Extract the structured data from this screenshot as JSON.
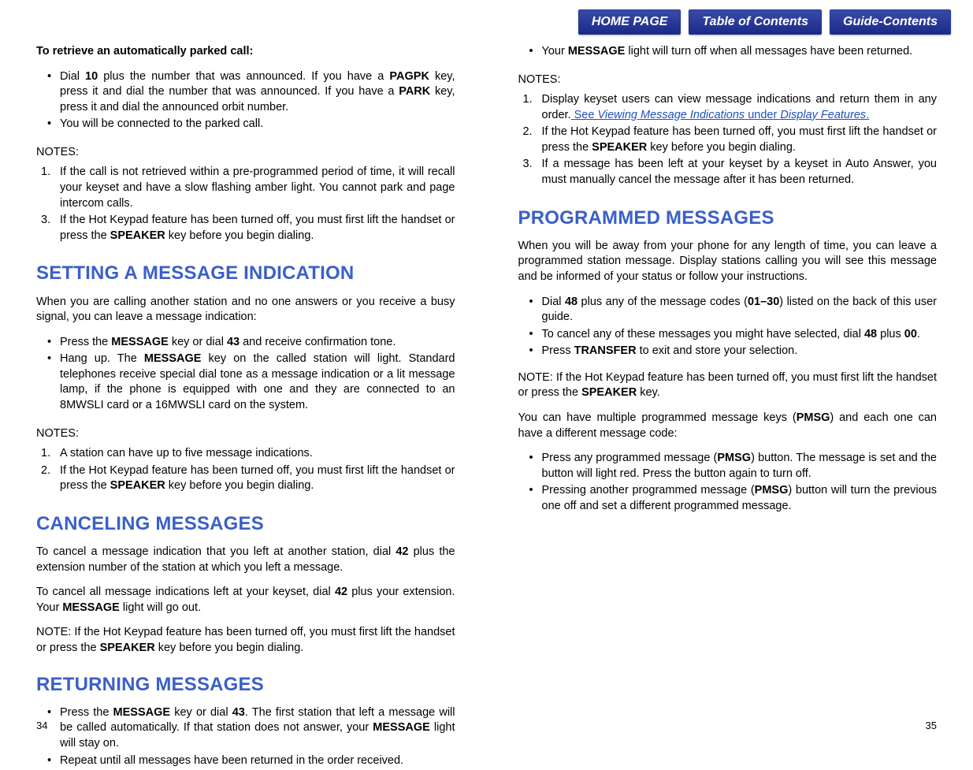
{
  "nav": {
    "home": "HOME PAGE",
    "toc": "Table of Contents",
    "guide": "Guide-Contents"
  },
  "left": {
    "retrieve_intro": "To retrieve an automatically parked call:",
    "retrieve_b1_a": "Dial ",
    "retrieve_b1_b": "10",
    "retrieve_b1_c": " plus the number that was announced. If you have a ",
    "retrieve_b1_d": "PAGPK",
    "retrieve_b1_e": " key, press it and dial the number that was announced. If you have a ",
    "retrieve_b1_f": "PARK",
    "retrieve_b1_g": " key, press it and dial the announced orbit number.",
    "retrieve_b2": "You will be connected to the parked call.",
    "notes_label": "NOTES:",
    "retrieve_n1": "If the call is not retrieved within a pre-programmed period of time, it will recall your keyset and have a slow flashing amber light. You cannot park and page intercom calls.",
    "retrieve_n3_a": "If the Hot Keypad feature has been turned off, you must first lift the handset or press the ",
    "retrieve_n3_b": "SPEAKER",
    "retrieve_n3_c": " key before you begin dialing.",
    "setting_h": "SETTING A MESSAGE INDICATION",
    "setting_p": "When you are calling another station and no one answers or you receive a busy signal, you can leave a message indication:",
    "setting_b1_a": "Press the ",
    "setting_b1_b": "MESSAGE",
    "setting_b1_c": " key or dial ",
    "setting_b1_d": "43",
    "setting_b1_e": " and receive confirmation tone.",
    "setting_b2_a": "Hang up. The ",
    "setting_b2_b": "MESSAGE",
    "setting_b2_c": " key on the called station will light. Standard telephones receive special dial tone as a message indication or a lit message lamp, if the phone is equipped with one and they are connected to an 8MWSLI card or a 16MWSLI card on the system.",
    "setting_n1": "A station can have up to five message indications.",
    "setting_n2_a": "If the Hot Keypad feature has been turned off, you must first lift the handset or press the ",
    "setting_n2_b": "SPEAKER",
    "setting_n2_c": " key before you begin dialing.",
    "cancel_h": "CANCELING MESSAGES",
    "cancel_p1_a": "To cancel a message indication that you left at another station, dial ",
    "cancel_p1_b": "42",
    "cancel_p1_c": " plus the extension number of the station at which you left a message.",
    "cancel_p2_a": "To cancel all message indications left at your keyset, dial ",
    "cancel_p2_b": "42",
    "cancel_p2_c": " plus your extension. Your ",
    "cancel_p2_d": "MESSAGE",
    "cancel_p2_e": " light will go out.",
    "cancel_note_a": "NOTE:  If the Hot Keypad feature has been turned off, you must first lift the handset or press the ",
    "cancel_note_b": "SPEAKER",
    "cancel_note_c": " key before you begin dialing.",
    "return_h": "RETURNING MESSAGES",
    "return_b1_a": "Press the ",
    "return_b1_b": "MESSAGE",
    "return_b1_c": " key or dial ",
    "return_b1_d": "43",
    "return_b1_e": ". The first station that left a message will be called automatically. If that station does not answer, your ",
    "return_b1_f": "MESSAGE",
    "return_b1_g": " light will stay on.",
    "return_b2": "Repeat until all messages have been returned in the order received.",
    "page_num": "34"
  },
  "right": {
    "return_b3_a": "Your ",
    "return_b3_b": "MESSAGE",
    "return_b3_c": " light will turn off when all messages have been returned.",
    "notes_label": "NOTES:",
    "return_n1_a": "Display keyset users can view message indications and return them in any order.",
    "return_n1_link_a": " See ",
    "return_n1_link_b": "Viewing Message Indications",
    "return_n1_link_c": " under ",
    "return_n1_link_d": "Display Features",
    "return_n1_link_e": ".",
    "return_n2_a": "If the Hot Keypad feature has been turned off, you must first lift the handset or press the ",
    "return_n2_b": "SPEAKER",
    "return_n2_c": " key before you begin dialing.",
    "return_n3": "If a message has been left at your keyset by a keyset in Auto Answer, you must manually cancel the message after it has been returned.",
    "prog_h": "PROGRAMMED MESSAGES",
    "prog_p": "When you will be away from your phone for any length of time, you can leave a programmed station message. Display stations calling you will see this message and be informed of your status or follow your instructions.",
    "prog_b1_a": "Dial ",
    "prog_b1_b": "48",
    "prog_b1_c": " plus any of the message codes (",
    "prog_b1_d": "01–30",
    "prog_b1_e": ") listed on the back of this user guide.",
    "prog_b2_a": "To cancel any of these messages you might have selected, dial ",
    "prog_b2_b": "48",
    "prog_b2_c": " plus ",
    "prog_b2_d": "00",
    "prog_b2_e": ".",
    "prog_b3_a": "Press ",
    "prog_b3_b": "TRANSFER",
    "prog_b3_c": " to exit and store your selection.",
    "prog_note_a": "NOTE:  If the Hot Keypad feature has been turned off, you must first lift the handset or press the ",
    "prog_note_b": "SPEAKER",
    "prog_note_c": " key.",
    "prog_p2_a": "You can have multiple programmed message keys (",
    "prog_p2_b": "PMSG",
    "prog_p2_c": ") and each one can have a different message code:",
    "prog_b4_a": "Press any programmed message (",
    "prog_b4_b": "PMSG",
    "prog_b4_c": ") button. The message is set and the button will light red. Press the button again to turn off.",
    "prog_b5_a": "Pressing another programmed message (",
    "prog_b5_b": "PMSG",
    "prog_b5_c": ") button will turn the previous one off and set a different programmed message.",
    "page_num": "35"
  }
}
